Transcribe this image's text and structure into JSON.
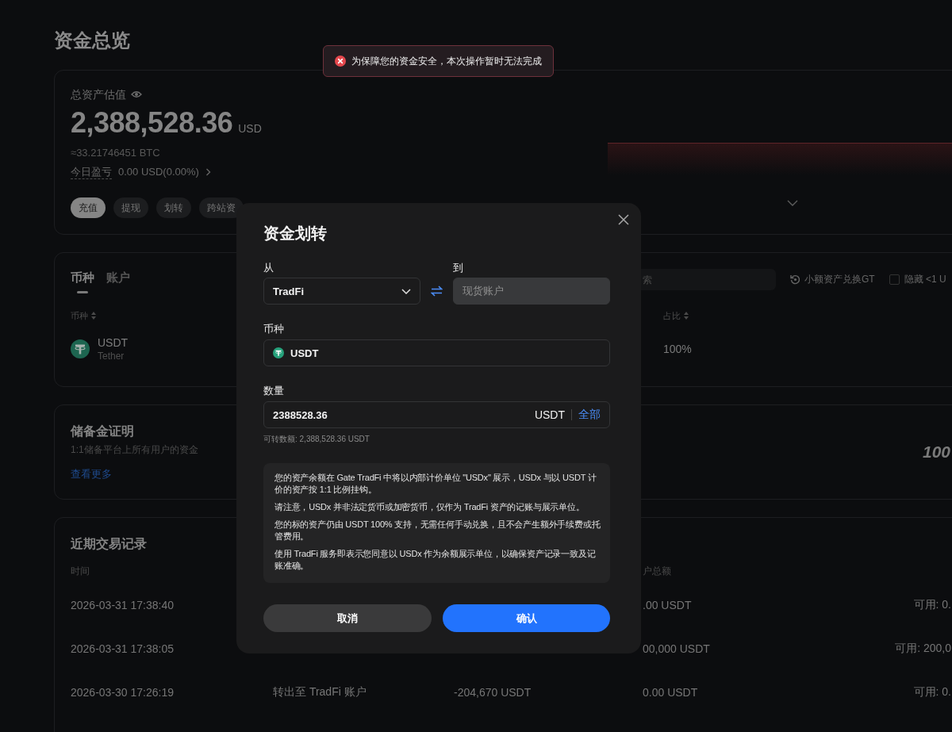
{
  "page": {
    "title": "资金总览"
  },
  "toast": {
    "kind": "error",
    "message": "为保障您的资金安全，本次操作暂时无法完成"
  },
  "overview": {
    "label": "总资产估值",
    "total": "2,388,528.36",
    "currency": "USD",
    "btc_equivalent": "≈33.21746451 BTC",
    "pnl_label": "今日盈亏",
    "pnl_value": "0.00 USD(0.00%)",
    "actions": [
      {
        "label": "充值",
        "kind": "primary"
      },
      {
        "label": "提现",
        "kind": "secondary"
      },
      {
        "label": "划转",
        "kind": "secondary"
      },
      {
        "label": "跨站资",
        "kind": "secondary"
      }
    ]
  },
  "assets": {
    "tabs": [
      {
        "label": "币种",
        "selected": true
      },
      {
        "label": "账户",
        "selected": false
      }
    ],
    "search": {
      "placeholder": "索"
    },
    "convert_link": "小额资产兑换GT",
    "hide_small": {
      "label": "隐藏 <1 U",
      "checked": false
    },
    "columns": [
      {
        "label": "币种"
      },
      {
        "label": "占比"
      }
    ],
    "rows": [
      {
        "symbol": "USDT",
        "name": "Tether",
        "share": "100%"
      }
    ]
  },
  "reserves": {
    "title": "储备金证明",
    "subtitle": "1:1储备平台上所有用户的资金",
    "link": "查看更多",
    "emblem": "100"
  },
  "history": {
    "title": "近期交易记录",
    "header": {
      "time": "时间",
      "balance": "户总额"
    },
    "rows": [
      {
        "time": "2026-03-31 17:38:40",
        "balance": ".00 USDT",
        "available": "可用: 0."
      },
      {
        "time": "2026-03-31 17:38:05",
        "balance": "00,000 USDT",
        "available": "可用: 200,0"
      },
      {
        "time": "2026-03-30 17:26:19",
        "description": "转出至 TradFi 账户",
        "amount": "-204,670 USDT",
        "balance": "0.00 USDT",
        "available": "可用: 0."
      }
    ]
  },
  "dialog": {
    "title": "资金划转",
    "from": {
      "label": "从",
      "value": "TradFi"
    },
    "to": {
      "label": "到",
      "value": "现货账户",
      "disabled": true
    },
    "coin": {
      "label": "币种",
      "value": "USDT"
    },
    "amount": {
      "label": "数量",
      "value": "2388528.36",
      "unit": "USDT",
      "max_label": "全部"
    },
    "available": "可转数额: 2,388,528.36 USDT",
    "notes": [
      "您的资产余额在 Gate TradFi 中将以内部计价单位 \"USDx\" 展示，USDx 与以 USDT 计价的资产按 1:1 比例挂钩。",
      "请注意，USDx 并非法定货币或加密货币，仅作为 TradFi 资产的记账与展示单位。",
      "您的标的资产仍由 USDT 100% 支持，无需任何手动兑换，且不会产生额外手续费或托管费用。",
      "使用 TradFi 服务即表示您同意以 USDx 作为余额展示单位，以确保资产记录一致及记账准确。"
    ],
    "buttons": [
      {
        "label": "取消",
        "kind": "secondary"
      },
      {
        "label": "确认",
        "kind": "primary"
      }
    ]
  }
}
